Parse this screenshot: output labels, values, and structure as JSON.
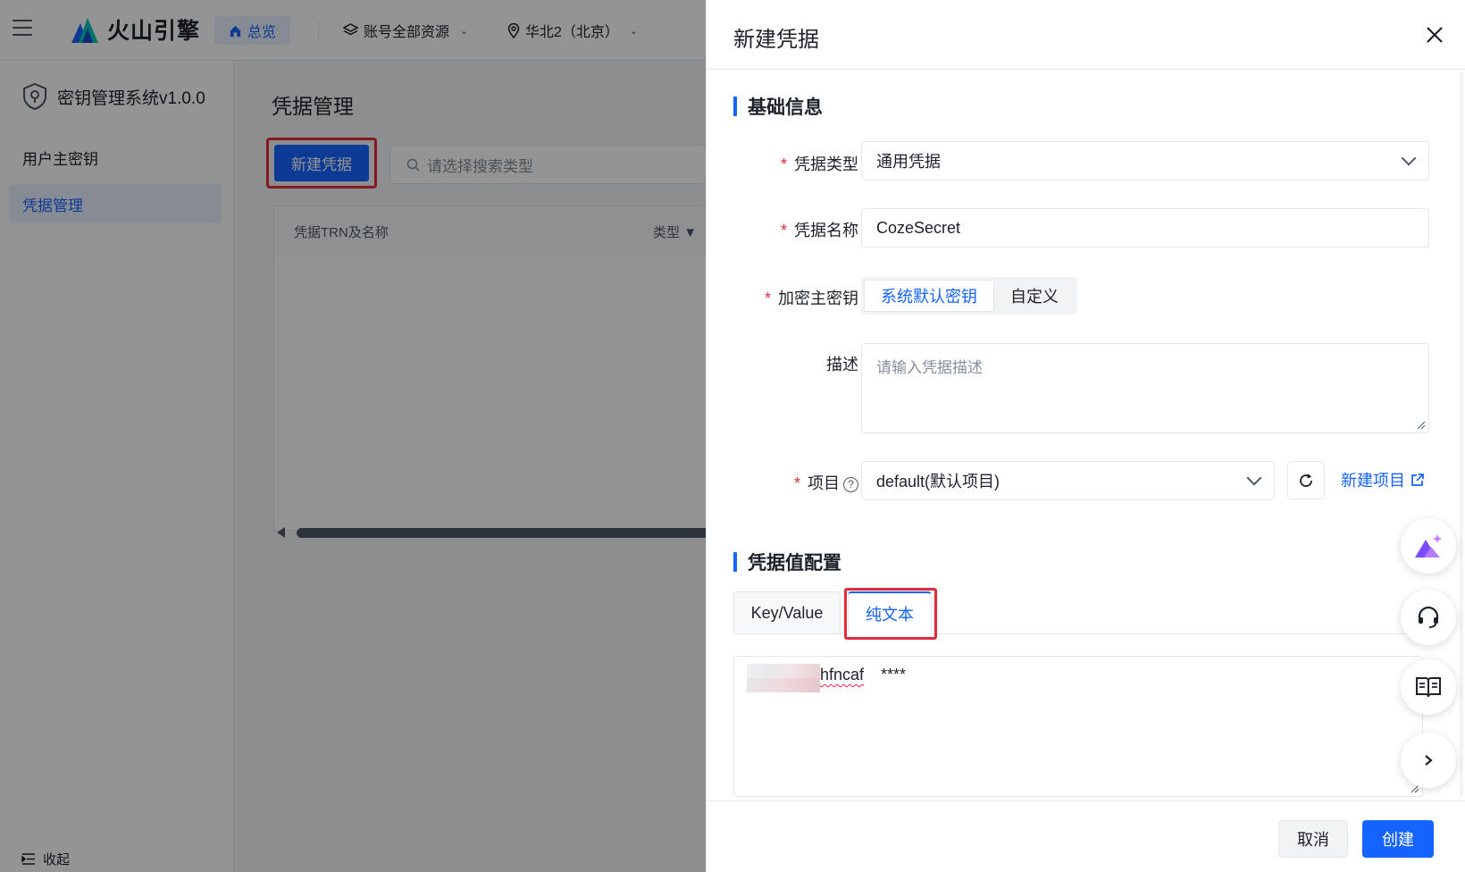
{
  "topbar": {
    "brand": "火山引擎",
    "home": "总览",
    "resource": "账号全部资源",
    "region": "华北2（北京）"
  },
  "sidebar": {
    "system_title": "密钥管理系统v1.0.0",
    "items": [
      {
        "label": "用户主密钥"
      },
      {
        "label": "凭据管理"
      }
    ],
    "collapse": "收起"
  },
  "main": {
    "title": "凭据管理",
    "new_button": "新建凭据",
    "search_placeholder": "请选择搜索类型",
    "columns": [
      "凭据TRN及名称",
      "类型"
    ]
  },
  "drawer": {
    "title": "新建凭据",
    "section_basic": "基础信息",
    "fields": {
      "type_label": "凭据类型",
      "type_value": "通用凭据",
      "name_label": "凭据名称",
      "name_value": "CozeSecret",
      "key_label": "加密主密钥",
      "key_options": [
        "系统默认密钥",
        "自定义"
      ],
      "desc_label": "描述",
      "desc_placeholder": "请输入凭据描述",
      "project_label": "项目",
      "project_value": "default(默认项目)",
      "new_project": "新建项目"
    },
    "section_value": "凭据值配置",
    "tabs": [
      "Key/Value",
      "纯文本"
    ],
    "secret_value_visible": "hfncaf",
    "secret_value_mask": "****",
    "cancel": "取消",
    "create": "创建"
  },
  "colors": {
    "primary": "#1664ff",
    "highlight": "#e5283a"
  }
}
